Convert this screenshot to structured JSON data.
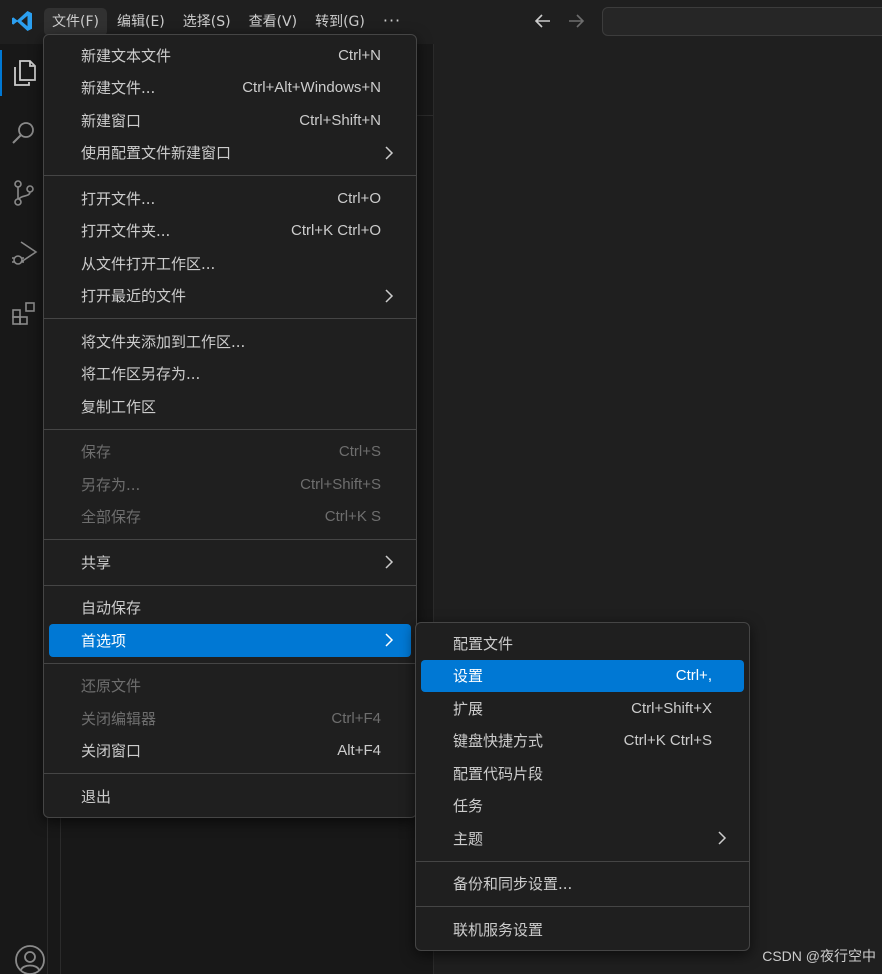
{
  "menubar": {
    "items": [
      {
        "label": "文件(F)",
        "active": true
      },
      {
        "label": "编辑(E)",
        "active": false
      },
      {
        "label": "选择(S)",
        "active": false
      },
      {
        "label": "查看(V)",
        "active": false
      },
      {
        "label": "转到(G)",
        "active": false
      }
    ],
    "more_label": "···"
  },
  "file_menu": {
    "groups": [
      [
        {
          "label": "新建文本文件",
          "shortcut": "Ctrl+N",
          "disabled": false,
          "submenu": false
        },
        {
          "label": "新建文件...",
          "shortcut": "Ctrl+Alt+Windows+N",
          "disabled": false,
          "submenu": false
        },
        {
          "label": "新建窗口",
          "shortcut": "Ctrl+Shift+N",
          "disabled": false,
          "submenu": false
        },
        {
          "label": "使用配置文件新建窗口",
          "shortcut": "",
          "disabled": false,
          "submenu": true
        }
      ],
      [
        {
          "label": "打开文件...",
          "shortcut": "Ctrl+O",
          "disabled": false,
          "submenu": false
        },
        {
          "label": "打开文件夹...",
          "shortcut": "Ctrl+K Ctrl+O",
          "disabled": false,
          "submenu": false
        },
        {
          "label": "从文件打开工作区...",
          "shortcut": "",
          "disabled": false,
          "submenu": false
        },
        {
          "label": "打开最近的文件",
          "shortcut": "",
          "disabled": false,
          "submenu": true
        }
      ],
      [
        {
          "label": "将文件夹添加到工作区...",
          "shortcut": "",
          "disabled": false,
          "submenu": false
        },
        {
          "label": "将工作区另存为...",
          "shortcut": "",
          "disabled": false,
          "submenu": false
        },
        {
          "label": "复制工作区",
          "shortcut": "",
          "disabled": false,
          "submenu": false
        }
      ],
      [
        {
          "label": "保存",
          "shortcut": "Ctrl+S",
          "disabled": true,
          "submenu": false
        },
        {
          "label": "另存为...",
          "shortcut": "Ctrl+Shift+S",
          "disabled": true,
          "submenu": false
        },
        {
          "label": "全部保存",
          "shortcut": "Ctrl+K S",
          "disabled": true,
          "submenu": false
        }
      ],
      [
        {
          "label": "共享",
          "shortcut": "",
          "disabled": false,
          "submenu": true
        }
      ],
      [
        {
          "label": "自动保存",
          "shortcut": "",
          "disabled": false,
          "submenu": false
        },
        {
          "label": "首选项",
          "shortcut": "",
          "disabled": false,
          "submenu": true,
          "selected": true
        }
      ],
      [
        {
          "label": "还原文件",
          "shortcut": "",
          "disabled": true,
          "submenu": false
        },
        {
          "label": "关闭编辑器",
          "shortcut": "Ctrl+F4",
          "disabled": true,
          "submenu": false
        },
        {
          "label": "关闭窗口",
          "shortcut": "Alt+F4",
          "disabled": false,
          "submenu": false
        }
      ],
      [
        {
          "label": "退出",
          "shortcut": "",
          "disabled": false,
          "submenu": false
        }
      ]
    ]
  },
  "preferences_menu": {
    "groups": [
      [
        {
          "label": "配置文件",
          "shortcut": "",
          "submenu": false
        },
        {
          "label": "设置",
          "shortcut": "Ctrl+,",
          "submenu": false,
          "selected": true
        },
        {
          "label": "扩展",
          "shortcut": "Ctrl+Shift+X",
          "submenu": false
        },
        {
          "label": "键盘快捷方式",
          "shortcut": "Ctrl+K Ctrl+S",
          "submenu": false
        },
        {
          "label": "配置代码片段",
          "shortcut": "",
          "submenu": false
        },
        {
          "label": "任务",
          "shortcut": "",
          "submenu": false
        },
        {
          "label": "主题",
          "shortcut": "",
          "submenu": true
        }
      ],
      [
        {
          "label": "备份和同步设置...",
          "shortcut": "",
          "submenu": false
        }
      ],
      [
        {
          "label": "联机服务设置",
          "shortcut": "",
          "submenu": false
        }
      ]
    ]
  },
  "activity_bar": {
    "icons": [
      "explorer-icon",
      "search-icon",
      "source-control-icon",
      "run-debug-icon",
      "extensions-icon",
      "account-icon"
    ]
  },
  "colors": {
    "accent": "#0078d4",
    "background": "#1f1f1f",
    "sidebar": "#181818",
    "text": "#cccccc",
    "disabled_text": "#6e6e6e"
  },
  "watermark": "CSDN @夜行空中"
}
